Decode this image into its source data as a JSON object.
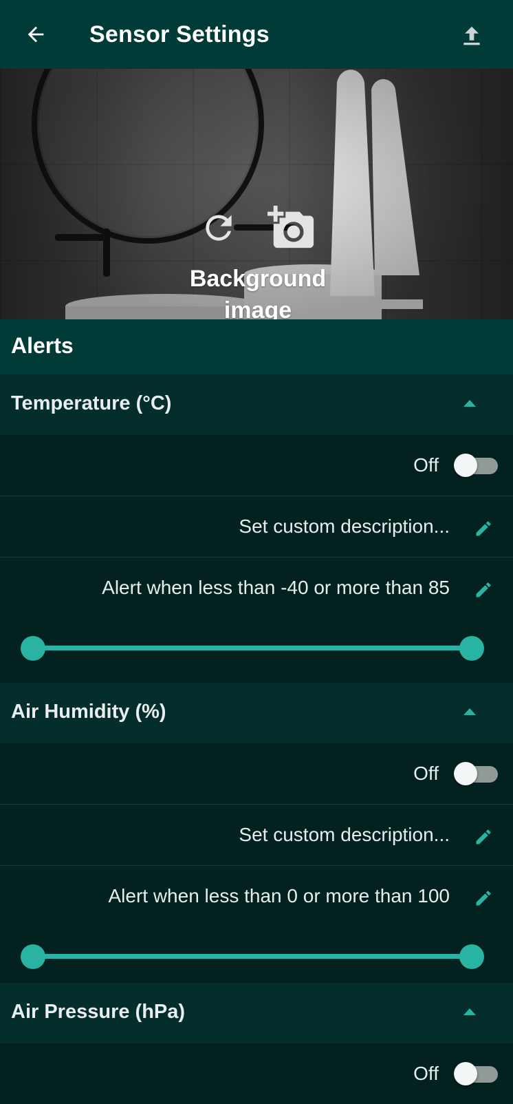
{
  "header": {
    "title": "Sensor Settings"
  },
  "icons": {
    "back": "arrow-left-icon",
    "upload": "upload-icon",
    "reload": "refresh-icon",
    "add_photo": "add-photo-icon",
    "collapse": "chevron-up-icon",
    "edit": "pencil-icon"
  },
  "background": {
    "label": "Background image"
  },
  "alerts": {
    "title": "Alerts",
    "groups": [
      {
        "name": "Temperature (°C)",
        "toggle_state": "Off",
        "description": "Set custom description...",
        "alert_text": "Alert when less than -40 or more than 85",
        "range": {
          "min": -40,
          "max": 85,
          "low": -40,
          "high": 85
        }
      },
      {
        "name": "Air Humidity (%)",
        "toggle_state": "Off",
        "description": "Set custom description...",
        "alert_text": "Alert when less than 0 or more than 100",
        "range": {
          "min": 0,
          "max": 100,
          "low": 0,
          "high": 100
        }
      },
      {
        "name": "Air Pressure (hPa)",
        "toggle_state": "Off"
      }
    ]
  },
  "colors": {
    "topbar": "#013b38",
    "accent": "#29b3a3",
    "background": "#02211f"
  }
}
